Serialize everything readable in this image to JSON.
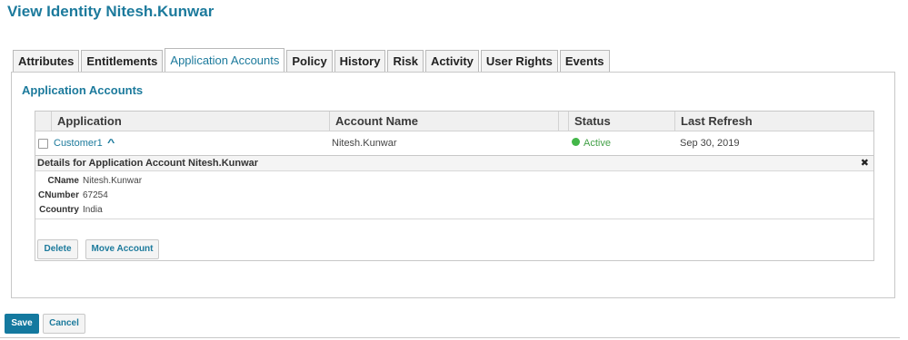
{
  "page": {
    "title": "View Identity Nitesh.Kunwar"
  },
  "tabs": [
    {
      "label": "Attributes"
    },
    {
      "label": "Entitlements"
    },
    {
      "label": "Application Accounts"
    },
    {
      "label": "Policy"
    },
    {
      "label": "History"
    },
    {
      "label": "Risk"
    },
    {
      "label": "Activity"
    },
    {
      "label": "User Rights"
    },
    {
      "label": "Events"
    }
  ],
  "active_tab": "Application Accounts",
  "section": {
    "title": "Application Accounts"
  },
  "table": {
    "headers": {
      "application": "Application",
      "account_name": "Account Name",
      "status": "Status",
      "last_refresh": "Last Refresh"
    },
    "rows": [
      {
        "application": "Customer1",
        "account_name": "Nitesh.Kunwar",
        "status": "Active",
        "last_refresh": "Sep 30, 2019"
      }
    ]
  },
  "details": {
    "title": "Details for Application Account Nitesh.Kunwar",
    "close": "✖",
    "attributes": [
      {
        "key": "CName",
        "value": "Nitesh.Kunwar"
      },
      {
        "key": "CNumber",
        "value": "67254"
      },
      {
        "key": "Ccountry",
        "value": "India"
      }
    ],
    "buttons": {
      "delete": "Delete",
      "move": "Move Account"
    }
  },
  "footer": {
    "save": "Save",
    "cancel": "Cancel"
  },
  "colors": {
    "accent": "#1c7a9c",
    "primary_button": "#14799f",
    "status_active": "#43b649"
  }
}
